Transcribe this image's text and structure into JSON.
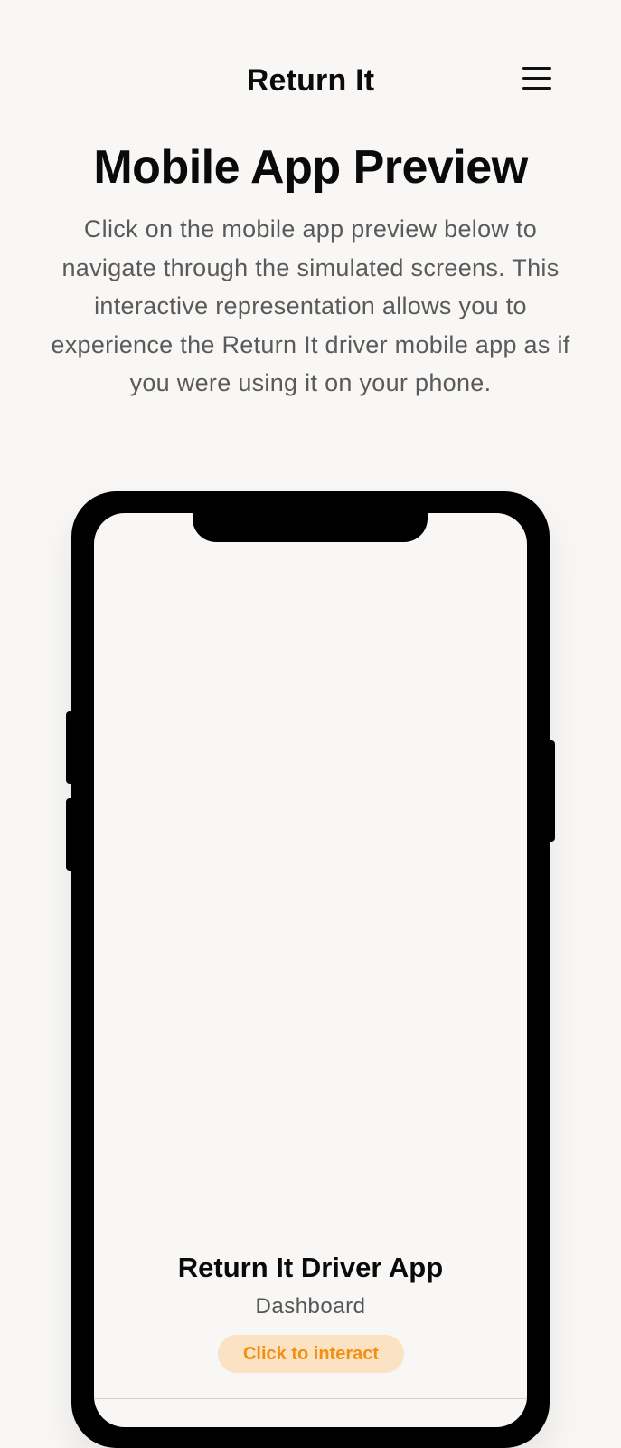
{
  "header": {
    "brand": "Return It",
    "menu_icon": "hamburger-menu-icon"
  },
  "main": {
    "title": "Mobile App Preview",
    "intro": "Click on the mobile app preview below to navigate through the simulated screens. This interactive representation allows you to experience the Return It driver mobile app as if you were using it on your phone."
  },
  "phone": {
    "app_name": "Return It Driver App",
    "screen_name": "Dashboard",
    "cta": "Click to interact",
    "colors": {
      "frame": "#000000",
      "screen": "#f8f7f5",
      "cta_bg": "#fbe2c2",
      "cta_text": "#f08f10"
    }
  }
}
